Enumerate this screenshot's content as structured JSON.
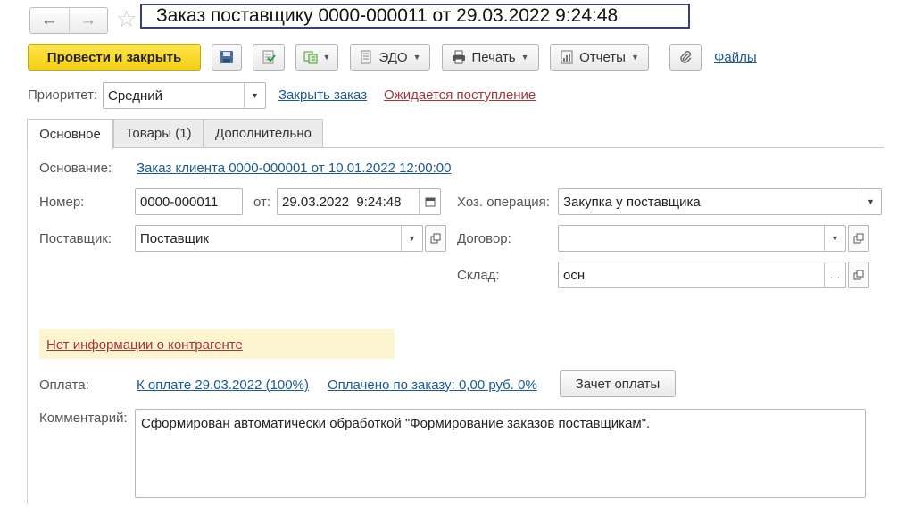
{
  "window": {
    "title": "Заказ поставщику 0000-000011 от 29.03.2022 9:24:48"
  },
  "nav": {
    "back_icon": "arrow-left-icon",
    "forward_icon": "arrow-right-icon",
    "favorite_icon": "star-icon"
  },
  "toolbar": {
    "post_close_label": "Провести и закрыть",
    "edo_label": "ЭДО",
    "print_label": "Печать",
    "reports_label": "Отчеты",
    "files_label": "Файлы"
  },
  "priority": {
    "label": "Приоритет:",
    "value": "Средний",
    "close_order_link": "Закрыть заказ",
    "status_link": "Ожидается поступление"
  },
  "tabs": [
    {
      "label": "Основное",
      "active": true
    },
    {
      "label": "Товары (1)",
      "active": false
    },
    {
      "label": "Дополнительно",
      "active": false
    }
  ],
  "form": {
    "basis_label": "Основание:",
    "basis_link": "Заказ клиента 0000-000001 от 10.01.2022 12:00:00",
    "number_label": "Номер:",
    "number_value": "0000-000011",
    "from_label": "от:",
    "date_value": "29.03.2022  9:24:48",
    "operation_label": "Хоз. операция:",
    "operation_value": "Закупка у поставщика",
    "supplier_label": "Поставщик:",
    "supplier_value": "Поставщик",
    "contract_label": "Договор:",
    "contract_value": "",
    "warehouse_label": "Склад:",
    "warehouse_value": "осн",
    "no_info_link": "Нет информации о контрагенте",
    "payment_label": "Оплата:",
    "payment_due_link": "К оплате 29.03.2022 (100%)",
    "paid_link": "Оплачено по заказу: 0,00 руб. 0%",
    "offset_button": "Зачет оплаты",
    "comment_label": "Комментарий:",
    "comment_value": "Сформирован автоматически обработкой \"Формирование заказов поставщикам\"."
  },
  "colors": {
    "accent": "#f5cf12",
    "link": "#1a5a94",
    "warning_link": "#a8343a",
    "warning_bg": "#fdf5cf",
    "title_border": "#3a3f7a"
  }
}
